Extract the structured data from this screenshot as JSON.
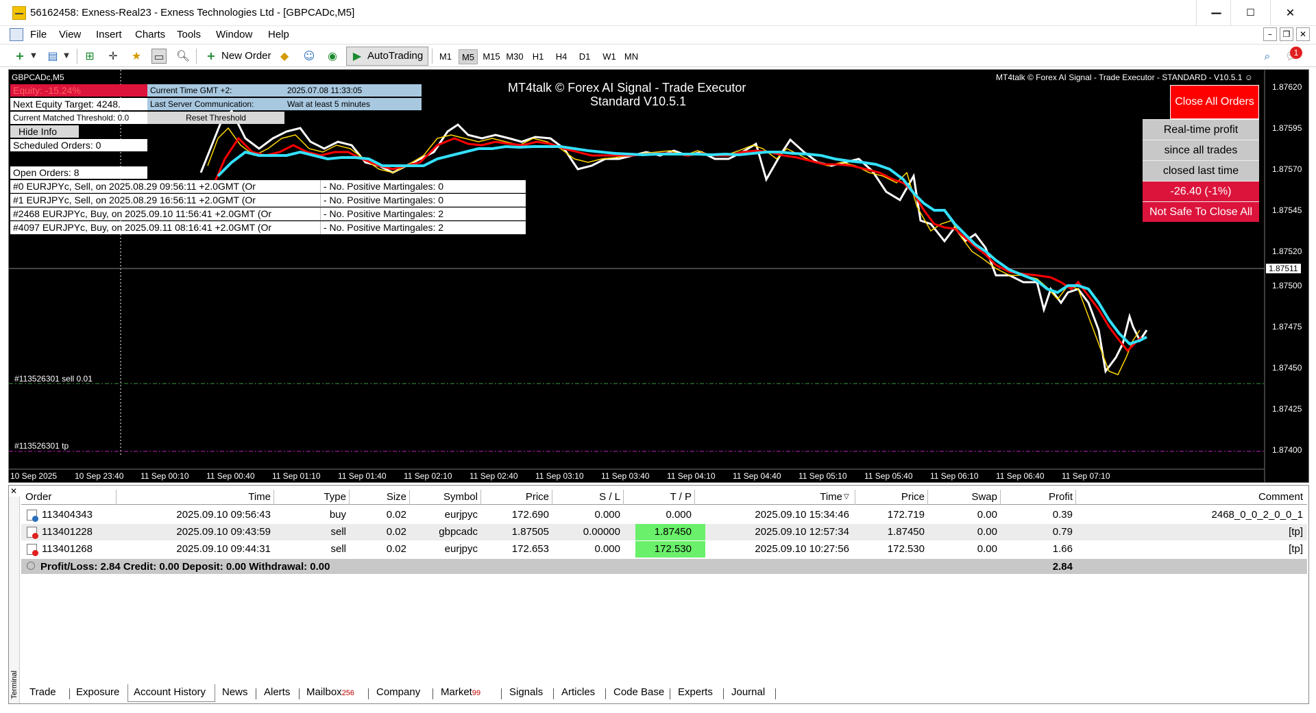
{
  "window": {
    "title": "56162458: Exness-Real23 - Exness Technologies Ltd - [GBPCADc,M5]",
    "minimize": "—",
    "maximize": "☐",
    "close": "✕"
  },
  "menu": [
    "File",
    "View",
    "Insert",
    "Charts",
    "Tools",
    "Window",
    "Help"
  ],
  "toolbar": {
    "new_order": "New Order",
    "autotrading": "AutoTrading",
    "timeframes": [
      "M1",
      "M5",
      "M15",
      "M30",
      "H1",
      "H4",
      "D1",
      "W1",
      "MN"
    ],
    "active_timeframe": "M5",
    "notification_count": "1"
  },
  "chart": {
    "symbol_label": "GBPCADc,M5",
    "title_line1": "MT4talk © Forex AI Signal - Trade Executor",
    "title_line2": "Standard V10.5.1",
    "top_right_label": "MT4talk © Forex AI Signal - Trade Executor - STANDARD - V10.5.1 ☺",
    "price_ticks": [
      "1.87620",
      "1.87595",
      "1.87570",
      "1.87545",
      "1.87520",
      "1.87500",
      "1.87475",
      "1.87450",
      "1.87425",
      "1.87400"
    ],
    "current_price": "1.87511",
    "time_ticks": [
      "10 Sep 2025",
      "10 Sep 23:40",
      "11 Sep 00:10",
      "11 Sep 00:40",
      "11 Sep 01:10",
      "11 Sep 01:40",
      "11 Sep 02:10",
      "11 Sep 02:40",
      "11 Sep 03:10",
      "11 Sep 03:40",
      "11 Sep 04:10",
      "11 Sep 04:40",
      "11 Sep 05:10",
      "11 Sep 05:40",
      "11 Sep 06:10",
      "11 Sep 06:40",
      "11 Sep 07:10"
    ],
    "order_line_sell": "#113526301 sell 0.01",
    "order_line_tp": "#113526301 tp",
    "colors": {
      "white_line": "#ffffff",
      "yellow_line": "#ffd700",
      "red_line": "#ff0000",
      "cyan_line": "#33e0ff"
    }
  },
  "panel": {
    "equity": "Equity: -15.24%",
    "next_target": "Next Equity Target: 4248.",
    "threshold": "Current Matched Threshold: 0.0",
    "hide_info": "Hide Info",
    "scheduled": "Scheduled Orders: 0",
    "open_orders": "Open Orders: 8",
    "time_label": "Current Time GMT +2:",
    "time_value": "2025.07.08 11:33:05",
    "server_label": "Last Server Communication:",
    "server_value": "Wait at least 5 minutes",
    "reset": "Reset Threshold",
    "orders": [
      {
        "left": "#0    EURJPYc, Sell, on 2025.08.29 09:56:11 +2.0GMT  (Or",
        "right": "- No. Positive Martingales: 0"
      },
      {
        "left": "#1    EURJPYc, Sell, on 2025.08.29 16:56:11 +2.0GMT  (Or",
        "right": "- No. Positive Martingales: 0"
      },
      {
        "left": "#2468 EURJPYc, Buy, on 2025.09.10 11:56:41 +2.0GMT  (Or",
        "right": "- No. Positive Martingales: 2"
      },
      {
        "left": "#4097 EURJPYc, Buy, on 2025.09.11 08:16:41 +2.0GMT  (Or",
        "right": "- No. Positive Martingales: 2"
      }
    ]
  },
  "right_buttons": {
    "close_all": "Close All Orders",
    "realtime_1": "Real-time profit",
    "realtime_2": "since all trades",
    "realtime_3": "closed last time",
    "profit": "-26.40 (-1%)",
    "not_safe": "Not Safe To Close All"
  },
  "terminal": {
    "side_label": "Terminal",
    "columns": [
      "Order",
      "Time",
      "Type",
      "Size",
      "Symbol",
      "Price",
      "S / L",
      "T / P",
      "Time",
      "Price",
      "Swap",
      "Profit",
      "Comment"
    ],
    "rows": [
      {
        "order": "113404343",
        "time": "2025.09.10 09:56:43",
        "type": "buy",
        "size": "0.02",
        "symbol": "eurjpyc",
        "price": "172.690",
        "sl": "0.000",
        "tp": "0.000",
        "close_time": "2025.09.10 15:34:46",
        "close_price": "172.719",
        "swap": "0.00",
        "profit": "0.39",
        "comment": "2468_0_0_2_0_0_1"
      },
      {
        "order": "113401228",
        "time": "2025.09.10 09:43:59",
        "type": "sell",
        "size": "0.02",
        "symbol": "gbpcadc",
        "price": "1.87505",
        "sl": "0.00000",
        "tp": "1.87450",
        "close_time": "2025.09.10 12:57:34",
        "close_price": "1.87450",
        "swap": "0.00",
        "profit": "0.79",
        "comment": "[tp]"
      },
      {
        "order": "113401268",
        "time": "2025.09.10 09:44:31",
        "type": "sell",
        "size": "0.02",
        "symbol": "eurjpyc",
        "price": "172.653",
        "sl": "0.000",
        "tp": "172.530",
        "close_time": "2025.09.10 10:27:56",
        "close_price": "172.530",
        "swap": "0.00",
        "profit": "1.66",
        "comment": "[tp]"
      }
    ],
    "summary": "Profit/Loss: 2.84  Credit: 0.00  Deposit: 0.00  Withdrawal: 0.00",
    "summary_profit": "2.84",
    "tabs": [
      {
        "label": "Trade"
      },
      {
        "label": "Exposure"
      },
      {
        "label": "Account History",
        "active": true
      },
      {
        "label": "News"
      },
      {
        "label": "Alerts"
      },
      {
        "label": "Mailbox",
        "badge": "256"
      },
      {
        "label": "Company"
      },
      {
        "label": "Market",
        "badge": "99"
      },
      {
        "label": "Signals"
      },
      {
        "label": "Articles"
      },
      {
        "label": "Code Base"
      },
      {
        "label": "Experts"
      },
      {
        "label": "Journal"
      }
    ]
  }
}
